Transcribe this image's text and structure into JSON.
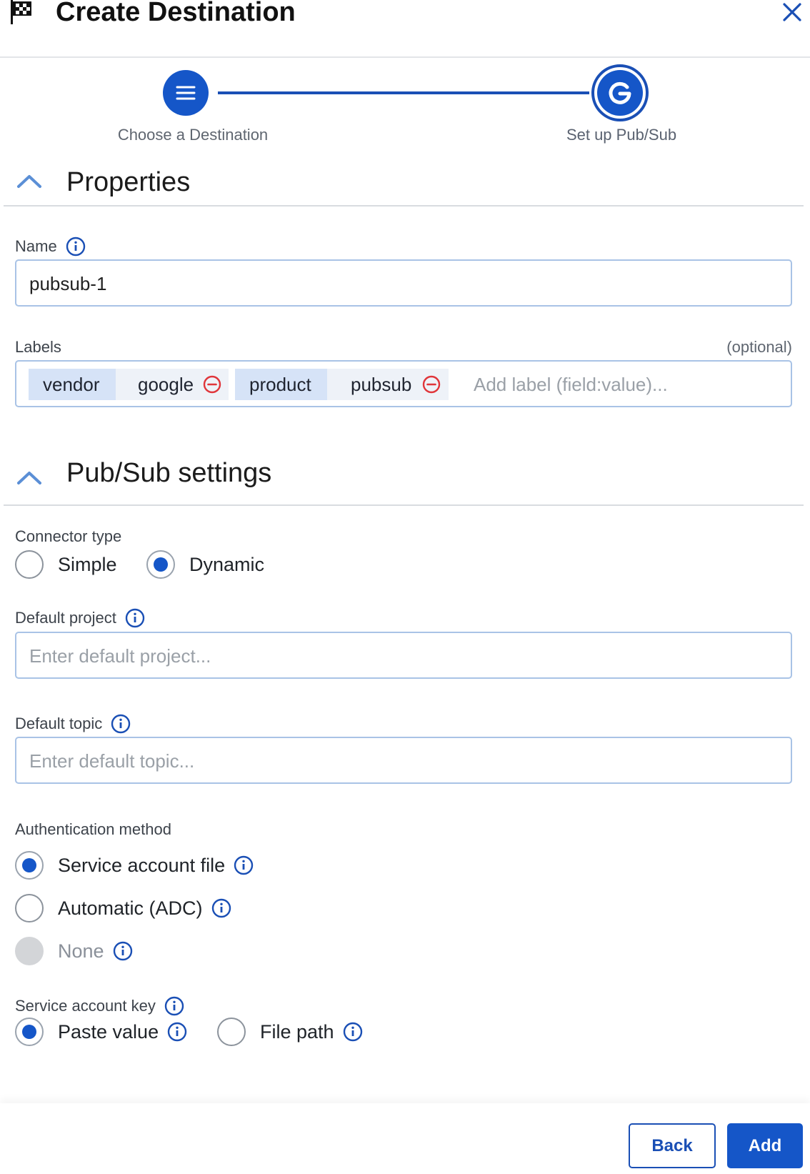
{
  "header": {
    "title": "Create Destination",
    "icon": "checkered-flag-icon",
    "close_icon": "close-icon"
  },
  "stepper": {
    "steps": [
      {
        "label": "Choose a Destination",
        "icon": "menu-lines-icon",
        "state": "completed"
      },
      {
        "label": "Set up Pub/Sub",
        "icon": "google-g-icon",
        "state": "active"
      }
    ]
  },
  "properties": {
    "title": "Properties",
    "name": {
      "label": "Name",
      "value": "pubsub-1"
    },
    "labels": {
      "label": "Labels",
      "optional": "(optional)",
      "chips": [
        {
          "key": "vendor",
          "value": "google"
        },
        {
          "key": "product",
          "value": "pubsub"
        }
      ],
      "placeholder": "Add label (field:value)..."
    }
  },
  "pubsub": {
    "title": "Pub/Sub settings",
    "connector_type": {
      "label": "Connector type",
      "options": [
        {
          "label": "Simple",
          "selected": false
        },
        {
          "label": "Dynamic",
          "selected": true
        }
      ]
    },
    "default_project": {
      "label": "Default project",
      "placeholder": "Enter default project..."
    },
    "default_topic": {
      "label": "Default topic",
      "placeholder": "Enter default topic..."
    },
    "auth_method": {
      "label": "Authentication method",
      "options": [
        {
          "label": "Service account file",
          "selected": true,
          "disabled": false
        },
        {
          "label": "Automatic (ADC)",
          "selected": false,
          "disabled": false
        },
        {
          "label": "None",
          "selected": false,
          "disabled": true
        }
      ]
    },
    "service_account_key": {
      "label": "Service account key",
      "options": [
        {
          "label": "Paste value",
          "selected": true
        },
        {
          "label": "File path",
          "selected": false
        }
      ]
    }
  },
  "footer": {
    "back_label": "Back",
    "add_label": "Add"
  },
  "colors": {
    "primary": "#1556c8",
    "remove": "#e0353a",
    "chip_key_bg": "#d6e3f7",
    "input_border": "#a9c3e6"
  }
}
